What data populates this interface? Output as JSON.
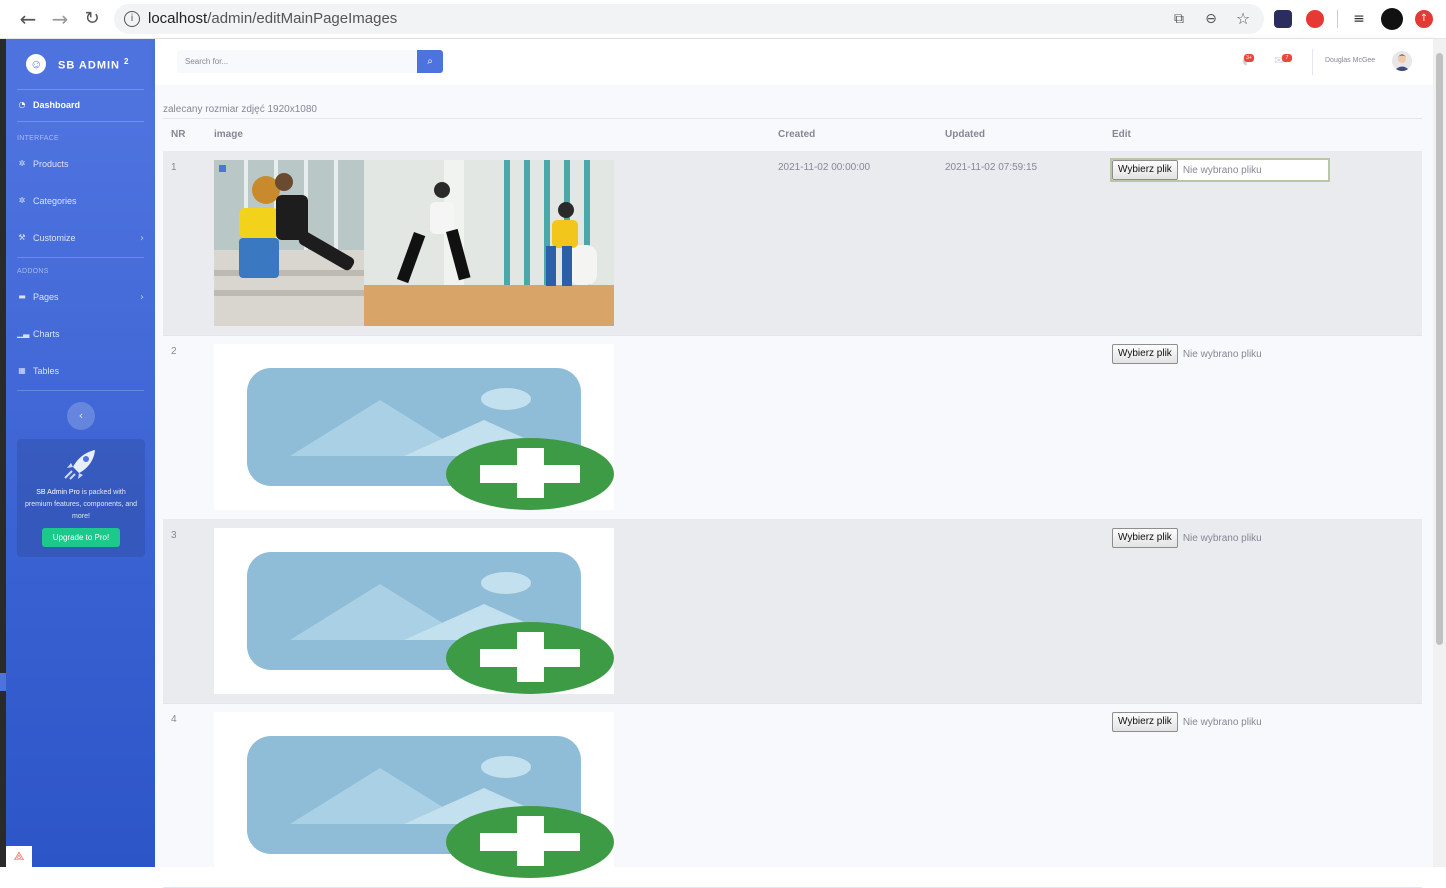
{
  "browser": {
    "url_host": "localhost",
    "url_path": "/admin/editMainPageImages"
  },
  "sidebar": {
    "brand": "SB ADMIN",
    "brand_sup": "2",
    "dashboard": "Dashboard",
    "heading_interface": "INTERFACE",
    "items_interface": [
      {
        "label": "Products",
        "icon": "cog-icon"
      },
      {
        "label": "Categories",
        "icon": "cog-icon"
      },
      {
        "label": "Customize",
        "icon": "wrench-icon"
      }
    ],
    "heading_addons": "ADDONS",
    "items_addons": [
      {
        "label": "Pages",
        "icon": "folder-icon"
      },
      {
        "label": "Charts",
        "icon": "chart-icon"
      },
      {
        "label": "Tables",
        "icon": "table-icon"
      }
    ],
    "promo": {
      "strong": "SB Admin Pro",
      "text": " is packed with premium features, components, and more!",
      "button": "Upgrade to Pro!"
    }
  },
  "topbar": {
    "search_placeholder": "Search for...",
    "alerts_badge": "3+",
    "messages_badge": "7",
    "user_name": "Douglas McGee"
  },
  "content": {
    "hint": "zalecany rozmiar zdjęć 1920x1080",
    "columns": [
      "NR",
      "image",
      "Created",
      "Updated",
      "Edit"
    ],
    "file_button": "Wybierz plik",
    "file_empty": "Nie wybrano pliku",
    "rows": [
      {
        "nr": "1",
        "image": "photo-rollerskaters",
        "created": "2021-11-02 00:00:00",
        "updated": "2021-11-02 07:59:15"
      },
      {
        "nr": "2",
        "image": "placeholder-add-image",
        "created": "",
        "updated": ""
      },
      {
        "nr": "3",
        "image": "placeholder-add-image",
        "created": "",
        "updated": ""
      },
      {
        "nr": "4",
        "image": "placeholder-add-image",
        "created": "",
        "updated": ""
      }
    ]
  },
  "colors": {
    "primary": "#4e73df",
    "success": "#1cc88a",
    "danger": "#e74a3b",
    "placeholder_frame": "#8fbcd6",
    "placeholder_plus": "#3d9b45"
  }
}
